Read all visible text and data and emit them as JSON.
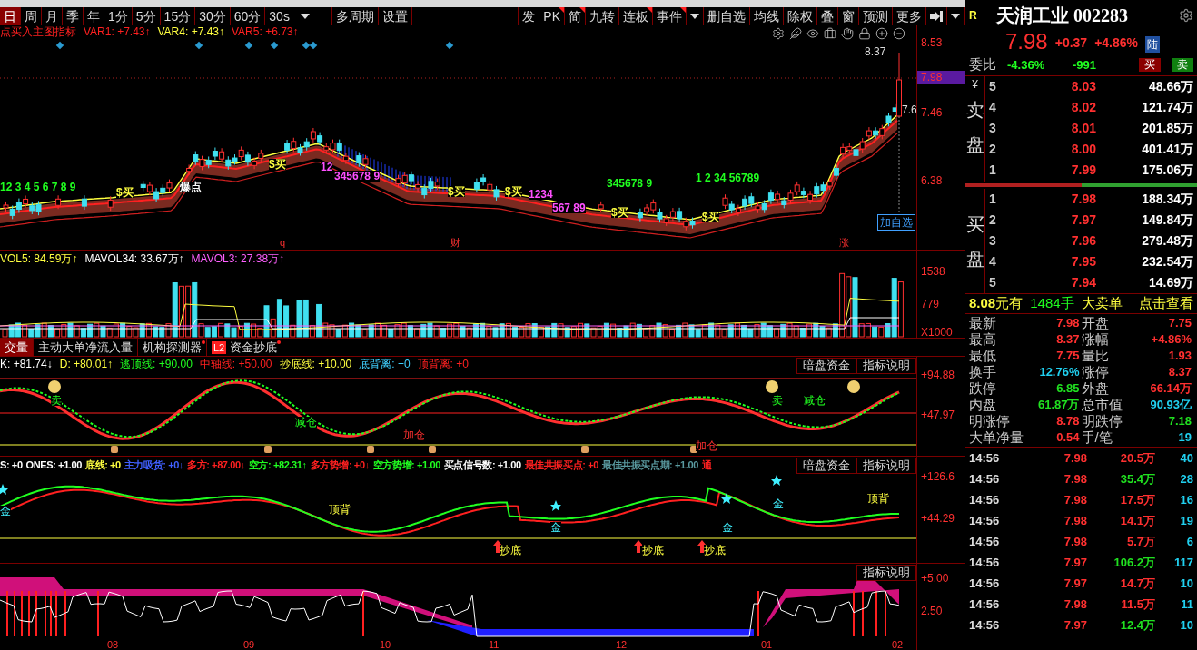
{
  "toolbar": {
    "periods": [
      {
        "label": "日",
        "selected": true
      },
      {
        "label": "周",
        "selected": false
      },
      {
        "label": "月",
        "selected": false
      },
      {
        "label": "季",
        "selected": false
      },
      {
        "label": "年",
        "selected": false
      },
      {
        "label": "1分",
        "selected": false
      },
      {
        "label": "5分",
        "selected": false
      },
      {
        "label": "15分",
        "selected": false
      },
      {
        "label": "30分",
        "selected": false
      },
      {
        "label": "60分",
        "selected": false
      }
    ],
    "interval": "30s",
    "buttons": [
      "多周期",
      "设置"
    ],
    "tools": [
      {
        "label": "发",
        "flagged": false
      },
      {
        "label": "PK",
        "flagged": true
      },
      {
        "label": "简",
        "flagged": true
      },
      {
        "label": "九转",
        "flagged": false
      },
      {
        "label": "连板",
        "flagged": true
      },
      {
        "label": "事件",
        "flagged": true
      }
    ],
    "tools2": [
      "删自选",
      "均线",
      "除权",
      "叠",
      "窗",
      "预测",
      "更多"
    ]
  },
  "main_chart": {
    "indicator": "点买入主图指标",
    "values": [
      {
        "text": "VAR1: +7.43↑",
        "color": "#ff2020"
      },
      {
        "text": "VAR4: +7.43↑",
        "color": "#ffff40"
      },
      {
        "text": "VAR5: +6.73↑",
        "color": "#ff2020"
      }
    ],
    "axis": [
      "8.53",
      "7.46",
      "6.38"
    ],
    "price_tag": "7.98",
    "high_label": "8.37",
    "partial_label": "7.6",
    "add_button": "加自选",
    "date_marks": [
      "q",
      "财",
      "涨"
    ],
    "markers": [
      {
        "text": "$买",
        "kind": "buy"
      },
      {
        "text": "爆点",
        "kind": "note"
      },
      {
        "text": "$买",
        "kind": "buy"
      },
      {
        "text": "$买",
        "kind": "buy"
      },
      {
        "text": "$买",
        "kind": "buy"
      },
      {
        "text": "$买",
        "kind": "buy"
      },
      {
        "text": "$买",
        "kind": "buy"
      },
      {
        "text": "12 3 4 5 6 7 8 9",
        "kind": "seq_up"
      },
      {
        "text": "12",
        "kind": "seq_down"
      },
      {
        "text": "345678 9",
        "kind": "seq_down"
      },
      {
        "text": "1234",
        "kind": "seq_down"
      },
      {
        "text": "567 89",
        "kind": "seq_down"
      },
      {
        "text": "345678 9",
        "kind": "seq_up"
      },
      {
        "text": "1 2 34 56789",
        "kind": "seq_up"
      }
    ]
  },
  "volume": {
    "values": [
      {
        "text": "VOL5: 84.59万↑",
        "color": "#ffff40"
      },
      {
        "text": "MAVOL34: 33.67万↑",
        "color": "#ffffff"
      },
      {
        "text": "MAVOL3: 27.38万↑",
        "color": "#ff60ff"
      }
    ],
    "axis": [
      "1538",
      "779",
      "X1000"
    ]
  },
  "tabs": [
    {
      "label": "交量",
      "selected": true,
      "dot": false
    },
    {
      "label": "主动大单净流入量",
      "selected": false,
      "dot": false
    },
    {
      "label": "机构探测器",
      "selected": false,
      "dot": true
    },
    {
      "label": "资金抄底",
      "badge": "L2",
      "selected": false,
      "dot": true
    }
  ],
  "kd_panel": {
    "values": [
      {
        "text": "K: +81.74↓",
        "color": "#ffffff"
      },
      {
        "text": "D: +80.01↑",
        "color": "#ffff40"
      },
      {
        "text": "逃顶线: +90.00",
        "color": "#20ff20"
      },
      {
        "text": "中轴线: +50.00",
        "color": "#ff2020"
      },
      {
        "text": "抄底线: +10.00",
        "color": "#ffff40"
      },
      {
        "text": "底背离: +0",
        "color": "#40d0ff"
      },
      {
        "text": "顶背离: +0",
        "color": "#ff2020"
      }
    ],
    "buttons": [
      "暗盘资金",
      "指标说明"
    ],
    "axis": [
      "+94.88",
      "+47.97"
    ],
    "labels": [
      {
        "text": "卖",
        "kind": "sell"
      },
      {
        "text": "减仓",
        "kind": "reduce"
      },
      {
        "text": "加仓",
        "kind": "add"
      },
      {
        "text": "加仓",
        "kind": "add"
      },
      {
        "text": "卖",
        "kind": "sell"
      },
      {
        "text": "减仓",
        "kind": "reduce"
      }
    ]
  },
  "signal_panel": {
    "values": [
      {
        "text": "S: +0",
        "color": "#ffffff"
      },
      {
        "text": "ONES: +1.00",
        "color": "#ffffff"
      },
      {
        "text": "底线: +0",
        "color": "#ffff40"
      },
      {
        "text": "主力吸货: +0↓",
        "color": "#4060ff"
      },
      {
        "text": "多方: +87.00↓",
        "color": "#ff2020"
      },
      {
        "text": "空方: +82.31↑",
        "color": "#20ff20"
      },
      {
        "text": "多方势增: +0↓",
        "color": "#ff2020"
      },
      {
        "text": "空方势增: +1.00",
        "color": "#20ff20"
      },
      {
        "text": "买点信号数: +1.00",
        "color": "#ffffff"
      },
      {
        "text": "最佳共振买点: +0",
        "color": "#ff2020"
      },
      {
        "text": "最佳共振买点期: +1.00",
        "color": "#5a9aa0"
      },
      {
        "text": "通",
        "color": "#ff2020"
      }
    ],
    "buttons": [
      "暗盘资金",
      "指标说明"
    ],
    "axis": [
      "+126.6",
      "+44.29"
    ],
    "labels": [
      {
        "text": "金",
        "kind": "gold"
      },
      {
        "text": "顶背",
        "kind": "top"
      },
      {
        "text": "金",
        "kind": "gold"
      },
      {
        "text": "金",
        "kind": "gold"
      },
      {
        "text": "金",
        "kind": "gold"
      },
      {
        "text": "顶背",
        "kind": "top"
      },
      {
        "text": "抄底",
        "kind": "bottom"
      },
      {
        "text": "抄底",
        "kind": "bottom"
      },
      {
        "text": "抄底",
        "kind": "bottom"
      }
    ]
  },
  "bottom_panel": {
    "button": "指标说明",
    "axis": [
      "+5.00",
      "2.50"
    ],
    "months": [
      "08",
      "09",
      "10",
      "11",
      "12",
      "01",
      "02"
    ]
  },
  "quote": {
    "badge": "R",
    "title": "天润工业 002283",
    "price": "7.98",
    "change": "+0.37",
    "percent": "+4.86%",
    "market": "陆",
    "ratio_label": "委比",
    "ratio": "-4.36%",
    "ratio_diff": "-991",
    "buy": "买",
    "sell": "卖",
    "currency": "¥",
    "ask_label": "卖盘",
    "bid_label": "买盘",
    "asks": [
      {
        "level": "5",
        "price": "8.03",
        "volume": "48.66万"
      },
      {
        "level": "4",
        "price": "8.02",
        "volume": "121.74万"
      },
      {
        "level": "3",
        "price": "8.01",
        "volume": "201.85万"
      },
      {
        "level": "2",
        "price": "8.00",
        "volume": "401.41万"
      },
      {
        "level": "1",
        "price": "7.99",
        "volume": "175.06万"
      }
    ],
    "bids": [
      {
        "level": "1",
        "price": "7.98",
        "volume": "188.34万"
      },
      {
        "level": "2",
        "price": "7.97",
        "volume": "149.84万"
      },
      {
        "level": "3",
        "price": "7.96",
        "volume": "279.48万"
      },
      {
        "level": "4",
        "price": "7.95",
        "volume": "232.54万"
      },
      {
        "level": "5",
        "price": "7.94",
        "volume": "14.69万"
      }
    ],
    "big_order": {
      "price": "8.08",
      "unit": "元有",
      "lots": "1484手",
      "type": "大卖单",
      "link": "点击查看"
    },
    "stats": [
      {
        "label": "最新",
        "value": "7.98",
        "color": "#ff3030"
      },
      {
        "label": "开盘",
        "value": "7.75",
        "color": "#ff3030"
      },
      {
        "label": "最高",
        "value": "8.37",
        "color": "#ff3030"
      },
      {
        "label": "涨幅",
        "value": "+4.86%",
        "color": "#ff3030"
      },
      {
        "label": "最低",
        "value": "7.75",
        "color": "#ff3030"
      },
      {
        "label": "量比",
        "value": "1.93",
        "color": "#ff3030"
      },
      {
        "label": "换手",
        "value": "12.76%",
        "color": "#20d0f0"
      },
      {
        "label": "涨停",
        "value": "8.37",
        "color": "#ff3030"
      },
      {
        "label": "跌停",
        "value": "6.85",
        "color": "#20e020"
      },
      {
        "label": "外盘",
        "value": "66.14万",
        "color": "#ff3030"
      },
      {
        "label": "内盘",
        "value": "61.87万",
        "color": "#20e020"
      },
      {
        "label": "总市值",
        "value": "90.93亿",
        "color": "#20d0f0"
      },
      {
        "label": "明涨停",
        "value": "8.78",
        "color": "#ff3030"
      },
      {
        "label": "明跌停",
        "value": "7.18",
        "color": "#20e020"
      },
      {
        "label": "大单净量",
        "value": "0.54",
        "color": "#ff3030"
      },
      {
        "label": "手/笔",
        "value": "19",
        "color": "#20d0f0"
      }
    ],
    "trades": [
      {
        "time": "14:56",
        "price": "7.98",
        "volume": "20.5万",
        "count": "40",
        "color": "#ff3030"
      },
      {
        "time": "14:56",
        "price": "7.98",
        "volume": "35.4万",
        "count": "28",
        "color": "#20e020"
      },
      {
        "time": "14:56",
        "price": "7.98",
        "volume": "17.5万",
        "count": "16",
        "color": "#ff3030"
      },
      {
        "time": "14:56",
        "price": "7.98",
        "volume": "14.1万",
        "count": "19",
        "color": "#ff3030"
      },
      {
        "time": "14:56",
        "price": "7.98",
        "volume": "5.7万",
        "count": "6",
        "color": "#ff3030"
      },
      {
        "time": "14:56",
        "price": "7.97",
        "volume": "106.2万",
        "count": "117",
        "color": "#20e020"
      },
      {
        "time": "14:56",
        "price": "7.97",
        "volume": "14.7万",
        "count": "10",
        "color": "#ff3030"
      },
      {
        "time": "14:56",
        "price": "7.98",
        "volume": "11.5万",
        "count": "11",
        "color": "#ff3030"
      },
      {
        "time": "14:56",
        "price": "7.97",
        "volume": "12.4万",
        "count": "10",
        "color": "#20e020"
      }
    ]
  }
}
